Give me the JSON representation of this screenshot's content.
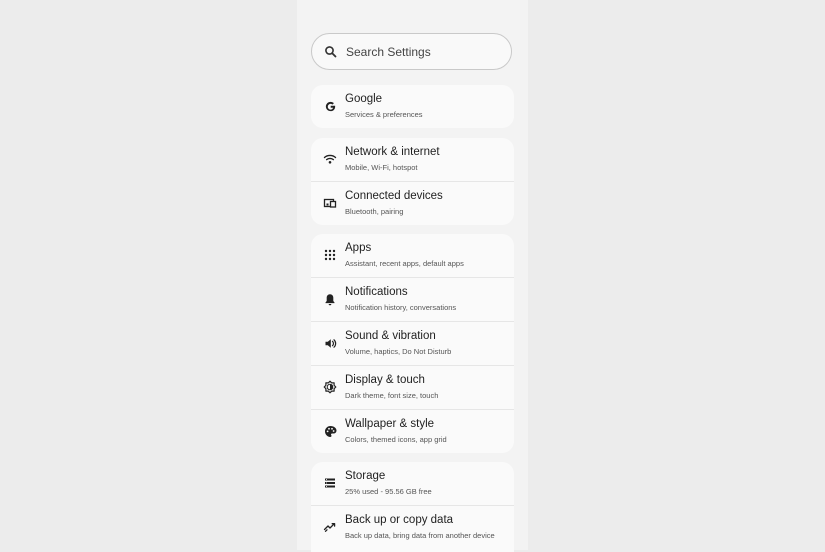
{
  "search": {
    "placeholder": "Search Settings"
  },
  "groups": [
    {
      "items": [
        {
          "title": "Google",
          "subtitle": "Services & preferences",
          "icon": "google-icon"
        }
      ]
    },
    {
      "items": [
        {
          "title": "Network & internet",
          "subtitle": "Mobile, Wi-Fi, hotspot",
          "icon": "wifi-icon"
        },
        {
          "title": "Connected devices",
          "subtitle": "Bluetooth, pairing",
          "icon": "connected-devices-icon"
        }
      ]
    },
    {
      "items": [
        {
          "title": "Apps",
          "subtitle": "Assistant, recent apps, default apps",
          "icon": "apps-grid-icon"
        },
        {
          "title": "Notifications",
          "subtitle": "Notification history, conversations",
          "icon": "bell-icon"
        },
        {
          "title": "Sound & vibration",
          "subtitle": "Volume, haptics, Do Not Disturb",
          "icon": "volume-icon"
        },
        {
          "title": "Display & touch",
          "subtitle": "Dark theme, font size, touch",
          "icon": "brightness-icon"
        },
        {
          "title": "Wallpaper & style",
          "subtitle": "Colors, themed icons, app grid",
          "icon": "palette-icon"
        }
      ]
    },
    {
      "items": [
        {
          "title": "Storage",
          "subtitle": "25% used - 95.56 GB free",
          "icon": "storage-icon"
        },
        {
          "title": "Back up or copy data",
          "subtitle": "Back up data, bring data from another device",
          "icon": "backup-sync-icon"
        }
      ]
    }
  ]
}
